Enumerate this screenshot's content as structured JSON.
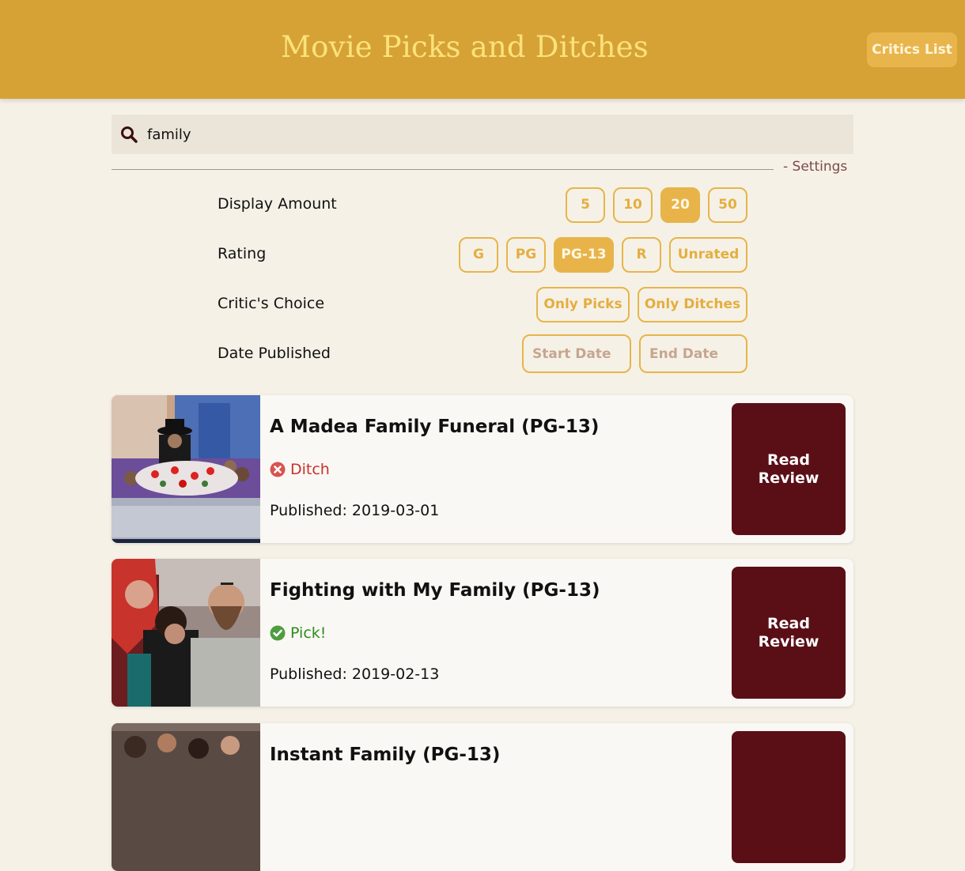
{
  "header": {
    "title": "Movie Picks and Ditches",
    "critics_button": "Critics List"
  },
  "search": {
    "value": "family"
  },
  "settings": {
    "toggle_label": "- Settings",
    "display_amount": {
      "label": "Display Amount",
      "options": [
        "5",
        "10",
        "20",
        "50"
      ],
      "selected": "20"
    },
    "rating": {
      "label": "Rating",
      "options": [
        "G",
        "PG",
        "PG-13",
        "R",
        "Unrated"
      ],
      "selected": "PG-13"
    },
    "critics_choice": {
      "label": "Critic's Choice",
      "options": [
        "Only Picks",
        "Only Ditches"
      ]
    },
    "date_published": {
      "label": "Date Published",
      "start_placeholder": "Start Date",
      "end_placeholder": "End Date"
    }
  },
  "results": [
    {
      "title": "A Madea Family Funeral (PG-13)",
      "verdict": "Ditch",
      "verdict_type": "ditch",
      "published": "Published: 2019-03-01",
      "button": "Read Review"
    },
    {
      "title": "Fighting with My Family (PG-13)",
      "verdict": "Pick!",
      "verdict_type": "pick",
      "published": "Published: 2019-02-13",
      "button": "Read Review"
    },
    {
      "title": "Instant Family (PG-13)",
      "verdict": "",
      "verdict_type": "",
      "published": "",
      "button": ""
    }
  ],
  "colors": {
    "header_bg": "#d6a236",
    "accent": "#e6b54a",
    "review_button": "#5a0f16",
    "ditch": "#c9302c",
    "pick": "#2e8b1e"
  }
}
